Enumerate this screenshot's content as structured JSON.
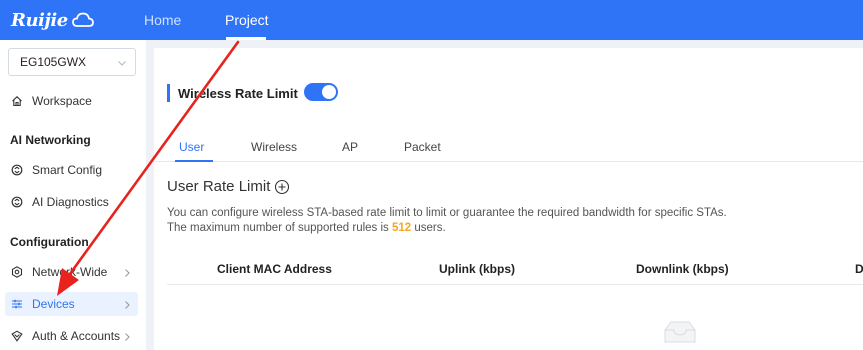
{
  "brand": {
    "logo_text": "Ruijie"
  },
  "topnav": {
    "home": "Home",
    "project": "Project"
  },
  "sidebar": {
    "device_select": "EG105GWX",
    "workspace": "Workspace",
    "section_ai": "AI Networking",
    "smart_config": "Smart Config",
    "ai_diagnostics": "AI Diagnostics",
    "section_config": "Configuration",
    "network_wide": "Network-Wide",
    "devices": "Devices",
    "auth_accounts": "Auth & Accounts"
  },
  "main": {
    "rate_limit_title": "Wireless Rate Limit",
    "rate_limit_enabled": true,
    "tabs": [
      "User",
      "Wireless",
      "AP",
      "Packet"
    ],
    "active_tab": "User",
    "section_title": "User Rate Limit",
    "desc_line1": "You can configure wireless STA-based rate limit to limit or guarantee the required bandwidth for specific STAs.",
    "desc_line2_prefix": "The maximum number of supported rules is ",
    "desc_line2_value": "512",
    "desc_line2_suffix": " users.",
    "table_headers": [
      "Client MAC Address",
      "Uplink (kbps)",
      "Downlink (kbps)",
      "D"
    ]
  },
  "colors": {
    "accent": "#2f74f6",
    "highlight": "#f5a623",
    "annotation": "#e8231e"
  }
}
